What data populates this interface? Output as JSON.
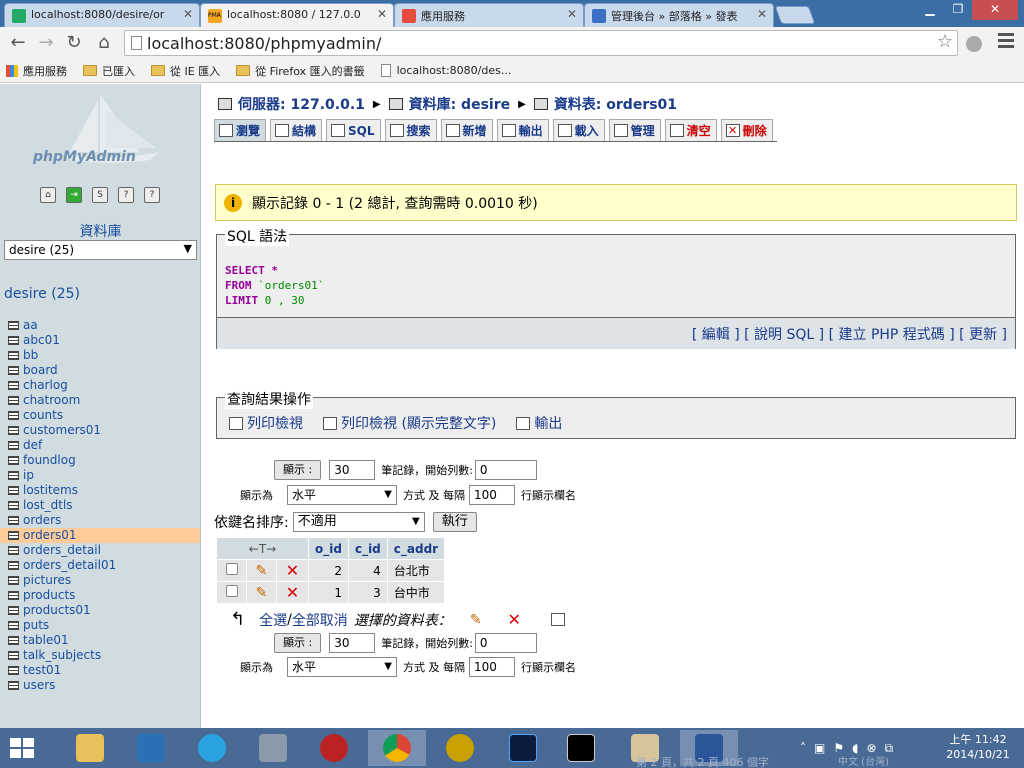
{
  "browser": {
    "tabs": [
      {
        "title": "localhost:8080/desire/or",
        "icon_color": "#2a6"
      },
      {
        "title": "localhost:8080 / 127.0.0",
        "icon_color": "#f5a623",
        "icon": "PMA"
      },
      {
        "title": "應用服務",
        "icon_color": "#e84c3d"
      },
      {
        "title": "管理後台 » 部落格 » 發表",
        "icon_color": "#3b6fc4"
      }
    ],
    "url": "localhost:8080/phpmyadmin/",
    "bookmarks": [
      "應用服務",
      "已匯入",
      "從 IE 匯入",
      "從 Firefox 匯入的書籤",
      "localhost:8080/des..."
    ]
  },
  "sidebar": {
    "logo": "phpMyAdmin",
    "db_label": "資料庫",
    "db_select": "desire (25)",
    "db_heading": "desire (25)",
    "tables": [
      "aa",
      "abc01",
      "bb",
      "board",
      "charlog",
      "chatroom",
      "counts",
      "customers01",
      "def",
      "foundlog",
      "ip",
      "lostitems",
      "lost_dtls",
      "orders",
      "orders01",
      "orders_detail",
      "orders_detail01",
      "pictures",
      "products",
      "products01",
      "puts",
      "table01",
      "talk_subjects",
      "test01",
      "users"
    ],
    "selected": "orders01"
  },
  "breadcrumb": {
    "server": "伺服器: 127.0.0.1",
    "database": "資料庫: desire",
    "table": "資料表: orders01"
  },
  "tabs": [
    {
      "label": "瀏覽"
    },
    {
      "label": "結構"
    },
    {
      "label": "SQL"
    },
    {
      "label": "搜索"
    },
    {
      "label": "新增"
    },
    {
      "label": "輸出"
    },
    {
      "label": "載入"
    },
    {
      "label": "管理"
    },
    {
      "label": "清空"
    },
    {
      "label": "刪除"
    }
  ],
  "notice": "顯示記錄 0 - 1 (2 總計, 查詢需時 0.0010 秒)",
  "sql": {
    "legend": "SQL 語法",
    "line1_kw": "SELECT",
    "line1_rest": " *",
    "line2_kw": "FROM",
    "line2_rest": " `orders01`",
    "line3_kw": "LIMIT",
    "line3_rest": " 0 , 30",
    "links": [
      "[ 編輯 ]",
      "[ 說明 SQL ]",
      "[ 建立 PHP 程式碼 ]",
      "[ 更新 ]"
    ]
  },
  "ops": {
    "legend": "查詢結果操作",
    "items": [
      "列印檢視",
      "列印檢視 (顯示完整文字)",
      "輸出"
    ]
  },
  "nav": {
    "show_btn": "顯示 :",
    "rows": "30",
    "rows_label": "筆記錄，開始列數:",
    "start": "0",
    "display_as": "顯示為",
    "mode": "水平",
    "mode_label": "方式 及 每隔",
    "repeat": "100",
    "repeat_label": "行顯示欄名"
  },
  "sort": {
    "label": "依鍵名排序:",
    "value": "不適用",
    "go": "執行"
  },
  "table": {
    "arrows": "←T→",
    "columns": [
      "o_id",
      "c_id",
      "c_addr"
    ],
    "rows": [
      {
        "o_id": "2",
        "c_id": "4",
        "c_addr": "台北市"
      },
      {
        "o_id": "1",
        "c_id": "3",
        "c_addr": "台中市"
      }
    ]
  },
  "with_selected": {
    "check_all": "全選",
    "sep": " / ",
    "uncheck_all": "全部取消",
    "label": "選擇的資料表："
  },
  "taskbar": {
    "clock_time": "上午 11:42",
    "clock_date": "2014/10/21",
    "ime": "中文 (台灣)",
    "faint": "第 2 頁，共 2 頁     406 個字"
  }
}
